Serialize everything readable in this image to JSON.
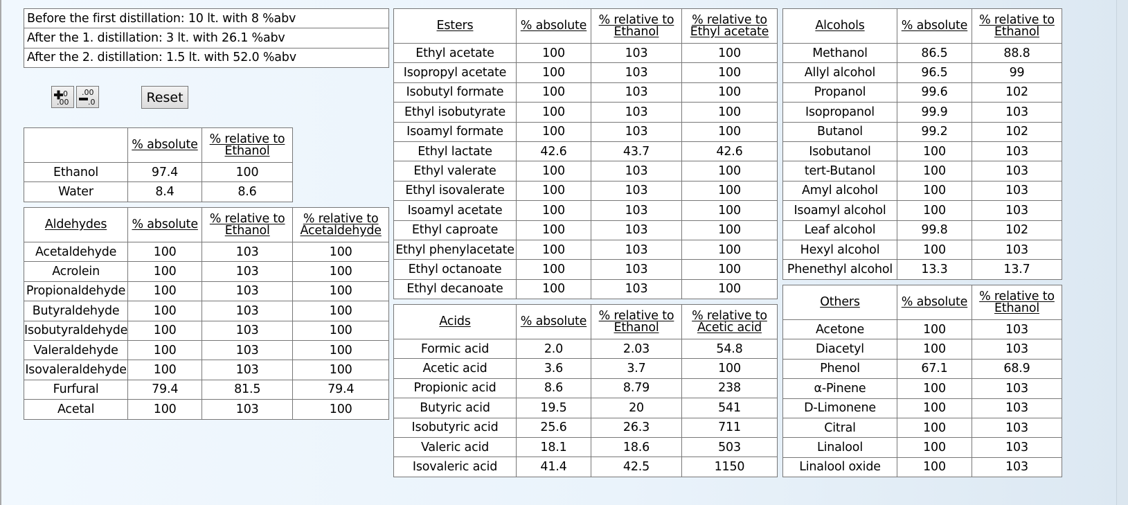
{
  "info": [
    "Before the first distillation: 10 lt. with 8 %abv",
    "After the 1. distillation: 3 lt. with 26.1 %abv",
    "After the 2. distillation: 1.5 lt. with 52.0 %abv"
  ],
  "controls": {
    "increase_decimals_icon": "increase-decimals",
    "decrease_decimals_icon": "decrease-decimals",
    "reset_label": "Reset"
  },
  "base": {
    "headers": [
      "",
      "% absolute",
      "% relative to Ethanol"
    ],
    "rows": [
      [
        "Ethanol",
        "97.4",
        "100"
      ],
      [
        "Water",
        "8.4",
        "8.6"
      ]
    ]
  },
  "aldehydes": {
    "headers": [
      "Aldehydes",
      "% absolute",
      "% relative to Ethanol",
      "% relative to Acetaldehyde"
    ],
    "rows": [
      [
        "Acetaldehyde",
        "100",
        "103",
        "100"
      ],
      [
        "Acrolein",
        "100",
        "103",
        "100"
      ],
      [
        "Propionaldehyde",
        "100",
        "103",
        "100"
      ],
      [
        "Butyraldehyde",
        "100",
        "103",
        "100"
      ],
      [
        "Isobutyraldehyde",
        "100",
        "103",
        "100"
      ],
      [
        "Valeraldehyde",
        "100",
        "103",
        "100"
      ],
      [
        "Isovaleraldehyde",
        "100",
        "103",
        "100"
      ],
      [
        "Furfural",
        "79.4",
        "81.5",
        "79.4"
      ],
      [
        "Acetal",
        "100",
        "103",
        "100"
      ]
    ]
  },
  "esters": {
    "headers": [
      "Esters",
      "% absolute",
      "% relative to Ethanol",
      "% relative to Ethyl acetate"
    ],
    "rows": [
      [
        "Ethyl acetate",
        "100",
        "103",
        "100"
      ],
      [
        "Isopropyl acetate",
        "100",
        "103",
        "100"
      ],
      [
        "Isobutyl formate",
        "100",
        "103",
        "100"
      ],
      [
        "Ethyl isobutyrate",
        "100",
        "103",
        "100"
      ],
      [
        "Isoamyl formate",
        "100",
        "103",
        "100"
      ],
      [
        "Ethyl lactate",
        "42.6",
        "43.7",
        "42.6"
      ],
      [
        "Ethyl valerate",
        "100",
        "103",
        "100"
      ],
      [
        "Ethyl isovalerate",
        "100",
        "103",
        "100"
      ],
      [
        "Isoamyl acetate",
        "100",
        "103",
        "100"
      ],
      [
        "Ethyl caproate",
        "100",
        "103",
        "100"
      ],
      [
        "Ethyl phenylacetate",
        "100",
        "103",
        "100"
      ],
      [
        "Ethyl octanoate",
        "100",
        "103",
        "100"
      ],
      [
        "Ethyl decanoate",
        "100",
        "103",
        "100"
      ]
    ]
  },
  "acids": {
    "headers": [
      "Acids",
      "% absolute",
      "% relative to Ethanol",
      "% relative to Acetic acid"
    ],
    "rows": [
      [
        "Formic acid",
        "2.0",
        "2.03",
        "54.8"
      ],
      [
        "Acetic acid",
        "3.6",
        "3.7",
        "100"
      ],
      [
        "Propionic acid",
        "8.6",
        "8.79",
        "238"
      ],
      [
        "Butyric acid",
        "19.5",
        "20",
        "541"
      ],
      [
        "Isobutyric acid",
        "25.6",
        "26.3",
        "711"
      ],
      [
        "Valeric acid",
        "18.1",
        "18.6",
        "503"
      ],
      [
        "Isovaleric acid",
        "41.4",
        "42.5",
        "1150"
      ]
    ]
  },
  "alcohols": {
    "headers": [
      "Alcohols",
      "% absolute",
      "% relative to Ethanol"
    ],
    "rows": [
      [
        "Methanol",
        "86.5",
        "88.8"
      ],
      [
        "Allyl alcohol",
        "96.5",
        "99"
      ],
      [
        "Propanol",
        "99.6",
        "102"
      ],
      [
        "Isopropanol",
        "99.9",
        "103"
      ],
      [
        "Butanol",
        "99.2",
        "102"
      ],
      [
        "Isobutanol",
        "100",
        "103"
      ],
      [
        "tert-Butanol",
        "100",
        "103"
      ],
      [
        "Amyl alcohol",
        "100",
        "103"
      ],
      [
        "Isoamyl alcohol",
        "100",
        "103"
      ],
      [
        "Leaf alcohol",
        "99.8",
        "102"
      ],
      [
        "Hexyl alcohol",
        "100",
        "103"
      ],
      [
        "Phenethyl alcohol",
        "13.3",
        "13.7"
      ]
    ]
  },
  "others": {
    "headers": [
      "Others",
      "% absolute",
      "% relative to Ethanol"
    ],
    "rows": [
      [
        "Acetone",
        "100",
        "103"
      ],
      [
        "Diacetyl",
        "100",
        "103"
      ],
      [
        "Phenol",
        "67.1",
        "68.9"
      ],
      [
        "α-Pinene",
        "100",
        "103"
      ],
      [
        "D-Limonene",
        "100",
        "103"
      ],
      [
        "Citral",
        "100",
        "103"
      ],
      [
        "Linalool",
        "100",
        "103"
      ],
      [
        "Linalool oxide",
        "100",
        "103"
      ]
    ]
  }
}
